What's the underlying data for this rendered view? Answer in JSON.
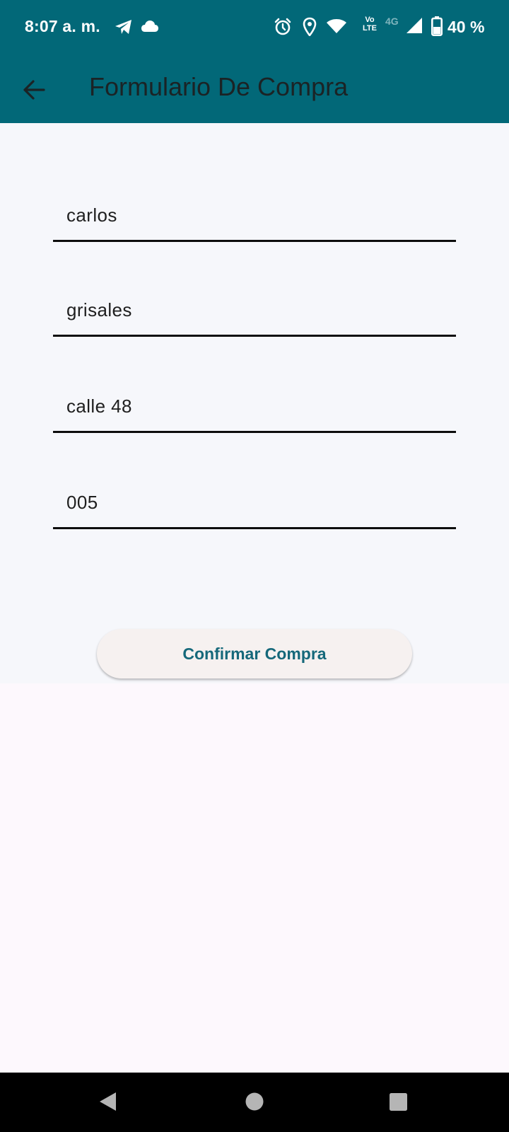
{
  "status_bar": {
    "time": "8:07 a. m.",
    "lte_label": "Vo LTE",
    "network_label": "4G",
    "battery": "40 %",
    "icons": [
      "telegram-icon",
      "cloud-icon",
      "alarm-icon",
      "location-icon",
      "wifi-icon",
      "volte-icon",
      "signal-icon",
      "battery-icon"
    ]
  },
  "app_bar": {
    "title": "Formulario De Compra",
    "back_icon": "arrow-back-icon"
  },
  "form": {
    "fields": [
      {
        "value": "carlos"
      },
      {
        "value": "grisales"
      },
      {
        "value": "calle 48"
      },
      {
        "value": "005"
      }
    ],
    "confirm_label": "Confirmar Compra"
  },
  "nav_bar": {
    "icons": [
      "back-triangle-icon",
      "home-circle-icon",
      "recents-square-icon"
    ]
  },
  "colors": {
    "primary": "#026878",
    "form_background": "#f6f7fb",
    "page_background": "#fdf8fd",
    "button_text": "#15687a",
    "button_background": "#f6f1f0"
  }
}
